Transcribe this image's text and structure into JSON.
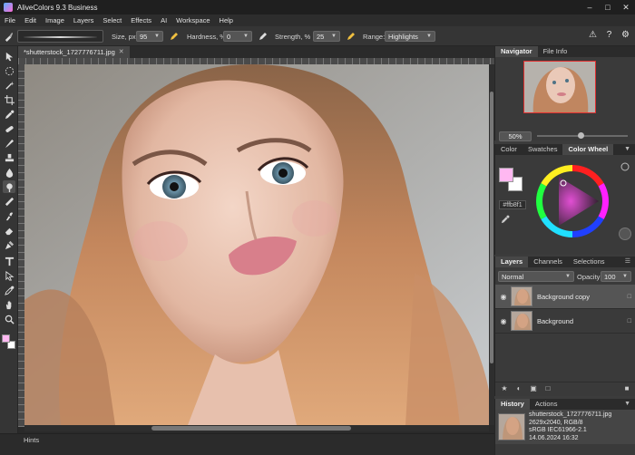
{
  "window": {
    "title": "AliveColors 9.3 Business",
    "controls": [
      "minimize-icon",
      "maximize-icon",
      "close-icon"
    ]
  },
  "menu": [
    "File",
    "Edit",
    "Image",
    "Layers",
    "Select",
    "Effects",
    "AI",
    "Workspace",
    "Help"
  ],
  "options": {
    "size_label": "Size, px",
    "size_value": "95",
    "hardness_label": "Hardness, %",
    "hardness_value": "0",
    "strength_label": "Strength, %",
    "strength_value": "25",
    "range_label": "Range:",
    "range_value": "Highlights"
  },
  "document": {
    "tab_title": "*shutterstock_1727776711.jpg"
  },
  "navigator": {
    "tabs": [
      "Navigator",
      "File Info"
    ],
    "active_tab": "Navigator",
    "zoom": "50%",
    "zoom_slider_fraction": 0.48
  },
  "color_panel": {
    "tabs": [
      "Color",
      "Swatches",
      "Color Wheel"
    ],
    "active_tab": "Color Wheel",
    "hex": "#ffb8f1",
    "foreground_color": "#ffb8f1",
    "background_color": "#ffffff"
  },
  "layers_panel": {
    "tabs": [
      "Layers",
      "Channels",
      "Selections"
    ],
    "active_tab": "Layers",
    "blend_mode": "Normal",
    "opacity_label": "Opacity:",
    "opacity_value": "100",
    "layers": [
      {
        "name": "Background copy",
        "selected": true
      },
      {
        "name": "Background",
        "selected": false
      }
    ]
  },
  "history_panel": {
    "tabs": [
      "History",
      "Actions"
    ],
    "active_tab": "History",
    "item": {
      "line1": "shutterstock_1727776711.jpg",
      "line2": "2629x2040, RGB/8",
      "line3": "sRGB IEC61966-2.1",
      "line4": "14.06.2024 16:32"
    }
  },
  "status": {
    "hints": "Hints"
  }
}
